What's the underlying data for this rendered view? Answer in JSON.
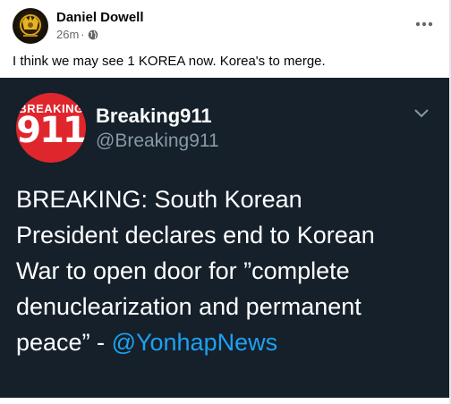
{
  "post": {
    "author": "Daniel Dowell",
    "timestamp": "26m",
    "separator": "·",
    "privacy_icon": "globe-icon",
    "more_icon": "more-horizontal-icon",
    "text": "I think we may see 1 KOREA now. Korea's to merge."
  },
  "tweet": {
    "avatar_top_text": "BREAKING",
    "avatar_number": "911",
    "display_name": "Breaking911",
    "handle": "@Breaking911",
    "body_lines": [
      "BREAKING: South Korean",
      "President declares end to Korean",
      "War to open door for ”complete",
      "denuclearization and permanent",
      "peace” - "
    ],
    "mention": "@YonhapNews",
    "chevron_icon": "chevron-down-icon",
    "colors": {
      "background": "#15202b",
      "mention": "#1da1f2",
      "handle": "#8899a6",
      "avatar": "#e0262d"
    }
  }
}
